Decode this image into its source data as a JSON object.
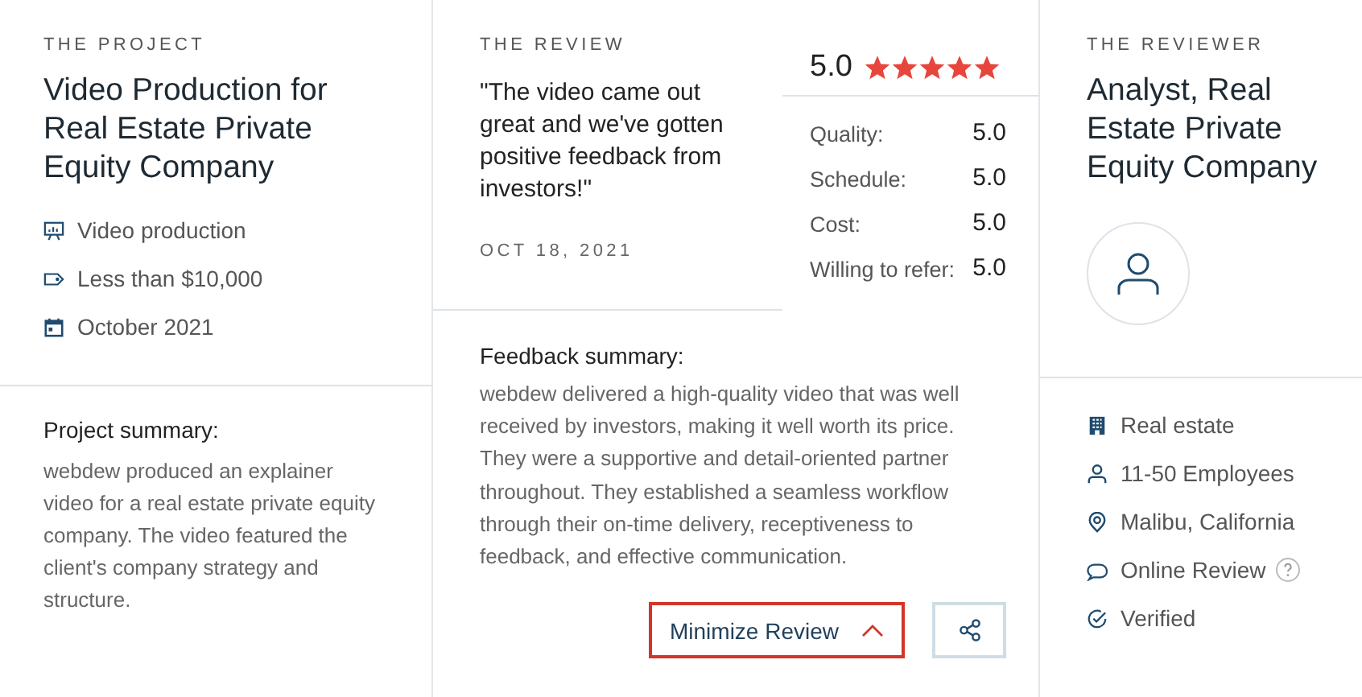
{
  "project": {
    "heading": "THE PROJECT",
    "title": "Video Production for Real Estate Private Equity Company",
    "facts": [
      {
        "kind": "service",
        "text": "Video production"
      },
      {
        "kind": "budget",
        "text": "Less than $10,000"
      },
      {
        "kind": "date",
        "text": "October 2021"
      }
    ],
    "summary_label": "Project summary:",
    "summary": "webdew produced an explainer video for a real estate private equity company. The video featured the client's company strategy and structure."
  },
  "review": {
    "heading": "THE REVIEW",
    "quote": "\"The video came out great and we've gotten positive feedback from investors!\"",
    "date": "OCT 18, 2021",
    "overall": "5.0",
    "stars": 5,
    "ratings": [
      {
        "label": "Quality:",
        "value": "5.0"
      },
      {
        "label": "Schedule:",
        "value": "5.0"
      },
      {
        "label": "Cost:",
        "value": "5.0"
      },
      {
        "label": "Willing to refer:",
        "value": "5.0"
      }
    ],
    "feedback_label": "Feedback summary:",
    "feedback": "webdew delivered a high-quality video that was well received by investors, making it well worth its price. They were a supportive and detail-oriented partner throughout. They established a seamless workflow through their on-time delivery, receptiveness to feedback, and effective communication.",
    "minimize_button": "Minimize Review"
  },
  "reviewer": {
    "heading": "THE REVIEWER",
    "title": "Analyst, Real Estate Private Equity Company",
    "facts": [
      {
        "kind": "industry",
        "text": "Real estate",
        "help": false
      },
      {
        "kind": "size",
        "text": "11-50 Employees",
        "help": false
      },
      {
        "kind": "location",
        "text": "Malibu, California",
        "help": false
      },
      {
        "kind": "source",
        "text": "Online Review",
        "help": true
      },
      {
        "kind": "verified",
        "text": "Verified",
        "help": false
      }
    ]
  }
}
